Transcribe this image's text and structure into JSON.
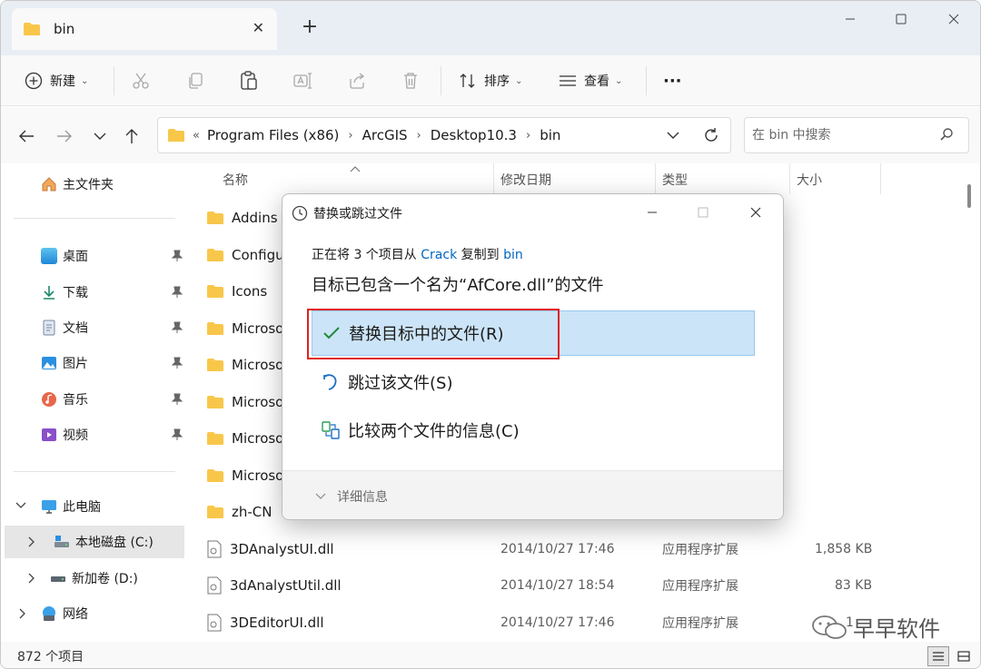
{
  "colors": {
    "accent": "#0067c0",
    "folder": "#f8c74a",
    "highlight": "#cce4f7",
    "annotation_box": "#e02020"
  },
  "tab": {
    "title": "bin",
    "close": "✕",
    "new": "+"
  },
  "window_controls": {
    "minimize": "—",
    "maximize": "☐",
    "close": "✕"
  },
  "toolbar": {
    "new_label": "新建",
    "sort_label": "排序",
    "view_label": "查看",
    "more_label": "···",
    "icons": [
      "cut-icon",
      "copy-icon",
      "paste-icon",
      "rename-icon",
      "share-icon",
      "delete-icon"
    ]
  },
  "address": {
    "breadcrumbs": [
      "Program Files (x86)",
      "ArcGIS",
      "Desktop10.3",
      "bin"
    ],
    "overflow": "«"
  },
  "search": {
    "placeholder": "在 bin 中搜索"
  },
  "sidebar": {
    "home": "主文件夹",
    "quick": [
      {
        "label": "桌面",
        "icon": "desktop-icon"
      },
      {
        "label": "下载",
        "icon": "download-icon"
      },
      {
        "label": "文档",
        "icon": "document-icon"
      },
      {
        "label": "图片",
        "icon": "picture-icon"
      },
      {
        "label": "音乐",
        "icon": "music-icon"
      },
      {
        "label": "视频",
        "icon": "video-icon"
      }
    ],
    "this_pc": "此电脑",
    "drive_c": "本地磁盘 (C:)",
    "drive_d": "新加卷 (D:)",
    "network": "网络"
  },
  "columns": {
    "name": "名称",
    "modified": "修改日期",
    "type": "类型",
    "size": "大小"
  },
  "folders": [
    "Addins",
    "Configu",
    "Icons",
    "Microso",
    "Microso",
    "Microso",
    "Microso",
    "Microso",
    "zh-CN"
  ],
  "files": [
    {
      "name": "3DAnalystUI.dll",
      "modified": "2014/10/27 17:46",
      "type": "应用程序扩展",
      "size": "1,858 KB"
    },
    {
      "name": "3dAnalystUtil.dll",
      "modified": "2014/10/27 18:54",
      "type": "应用程序扩展",
      "size": "83 KB"
    },
    {
      "name": "3DEditorUI.dll",
      "modified": "2014/10/27 17:46",
      "type": "应用程序扩展",
      "size": "1"
    }
  ],
  "status": {
    "count": "872 个项目"
  },
  "watermark": {
    "text": "早早软件"
  },
  "dialog": {
    "title": "替换或跳过文件",
    "msg_prefix": "正在将 3 个项目从 ",
    "msg_source": "Crack",
    "msg_mid": " 复制到 ",
    "msg_dest": "bin",
    "msg2": "目标已包含一个名为“AfCore.dll”的文件",
    "options": [
      "替换目标中的文件(R)",
      "跳过该文件(S)",
      "比较两个文件的信息(C)"
    ],
    "more_info": "详细信息"
  }
}
